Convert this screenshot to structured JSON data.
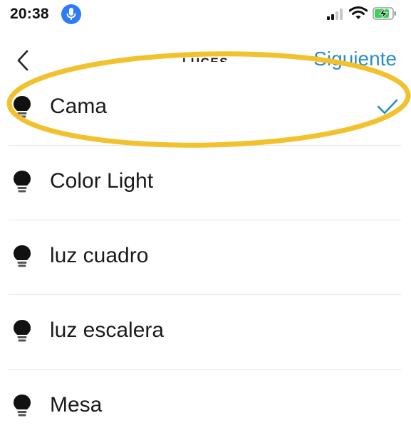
{
  "status_bar": {
    "time": "20:38",
    "icons": [
      "microphone-icon",
      "signal-icon",
      "wifi-icon",
      "battery-charging-icon"
    ]
  },
  "header": {
    "back_icon": "chevron-left-icon",
    "title": "LUCES",
    "next_label": "Siguiente"
  },
  "lights": [
    {
      "label": "Cama",
      "selected": true
    },
    {
      "label": "Color Light",
      "selected": false
    },
    {
      "label": "luz cuadro",
      "selected": false
    },
    {
      "label": "luz escalera",
      "selected": false
    },
    {
      "label": "Mesa",
      "selected": false
    }
  ],
  "colors": {
    "accent": "#2a8fbd",
    "check": "#2a8fbd",
    "highlight": "#f2c12e",
    "divider": "#e3e6ea",
    "mic": "#2f7bf5",
    "battery": "#3dd15a"
  }
}
